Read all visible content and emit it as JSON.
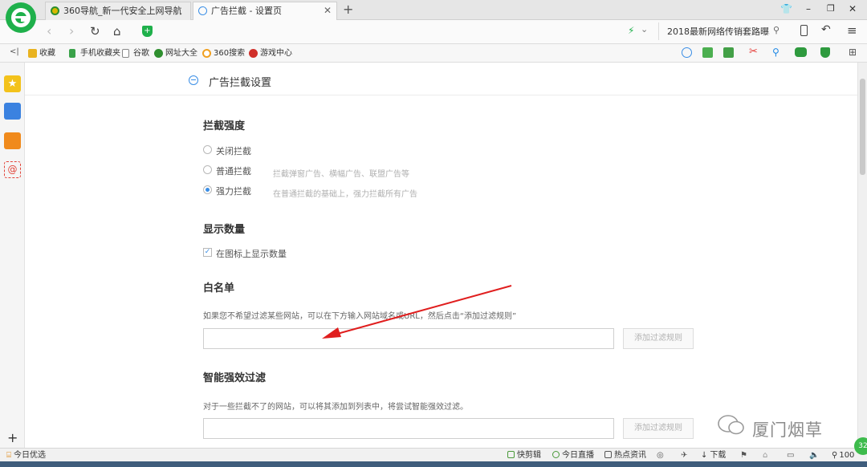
{
  "tabs": [
    {
      "label": "360导航_新一代安全上网导航"
    },
    {
      "label": "广告拦截 - 设置页"
    }
  ],
  "window_controls": {
    "minimize": "–",
    "restore": "❐",
    "close": "✕"
  },
  "address": {
    "value": "2018最新网络传销套路曝3"
  },
  "favorites": {
    "toggle": "<|",
    "items": [
      {
        "label": "收藏",
        "color": "#e9b320"
      },
      {
        "label": "手机收藏夹",
        "color": "#3aa24a"
      },
      {
        "label": "谷歌",
        "color": "#888888"
      },
      {
        "label": "网址大全",
        "color": "#2f8f2f"
      },
      {
        "label": "360搜索",
        "color": "#f0a020"
      },
      {
        "label": "游戏中心",
        "color": "#d0302a"
      }
    ]
  },
  "page": {
    "title": "广告拦截设置",
    "strength": {
      "title": "拦截强度",
      "options": [
        {
          "label": "关闭拦截",
          "hint": "",
          "selected": false
        },
        {
          "label": "普通拦截",
          "hint": "拦截弹窗广告、横幅广告、联盟广告等",
          "selected": false
        },
        {
          "label": "强力拦截",
          "hint": "在普通拦截的基础上，强力拦截所有广告",
          "selected": true
        }
      ]
    },
    "count": {
      "title": "显示数量",
      "checkbox_label": "在图标上显示数量",
      "checked": true
    },
    "whitelist": {
      "title": "白名单",
      "desc": "如果您不希望过滤某些网站，可以在下方输入网站域名或URL，然后点击“添加过滤规则”",
      "button": "添加过滤规则"
    },
    "smart": {
      "title": "智能强效过滤",
      "desc": "对于一些拦截不了的网站，可以将其添加到列表中，将尝试智能强效过滤。",
      "button": "添加过滤规则"
    }
  },
  "watermark": {
    "text": "厦门烟草"
  },
  "statusbar": {
    "left": "今日优选",
    "items": [
      "快剪辑",
      "今日直播",
      "热点资讯",
      "下载"
    ],
    "zoom": "100",
    "badge": "32"
  },
  "colors": {
    "accent": "#3a8ee6",
    "brand_green": "#1fb04b",
    "arrow": "#e01e1e"
  }
}
